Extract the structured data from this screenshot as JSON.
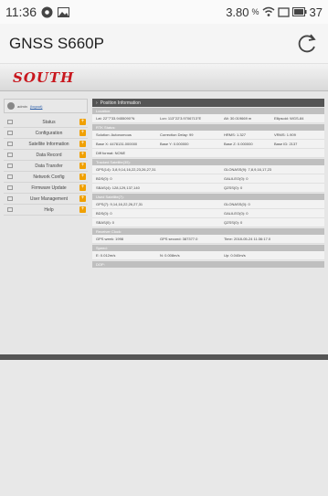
{
  "status_bar": {
    "time": "11:36",
    "battery_text": "3.80",
    "unit_text": "%",
    "trailing_text": "37"
  },
  "app_bar": {
    "title": "GNSS S660P"
  },
  "brand": {
    "logo": "SOUTH",
    "color": "#c8161d"
  },
  "user": {
    "name": "admin",
    "logout": "(logout)"
  },
  "sidebar": {
    "items": [
      {
        "label": "Status",
        "icon": "monitor-icon"
      },
      {
        "label": "Configuration",
        "icon": "tools-icon"
      },
      {
        "label": "Satellite Information",
        "icon": "satellite-icon"
      },
      {
        "label": "Data Record",
        "icon": "disk-icon"
      },
      {
        "label": "Data Transfer",
        "icon": "transfer-icon"
      },
      {
        "label": "Network Config",
        "icon": "network-icon"
      },
      {
        "label": "Firmware Update",
        "icon": "upload-icon"
      },
      {
        "label": "User Management",
        "icon": "user-icon"
      },
      {
        "label": "Help",
        "icon": "help-icon"
      }
    ]
  },
  "panel": {
    "header": "Position Information",
    "location": {
      "title": "Location:",
      "lat": "Lat: 22°7'33.9455090''N",
      "lon": "Lon: 113°22'3.9706713''E",
      "alt": "Alt: 30.019669 m",
      "ellipsoid": "Ellipsoid: WGS-84"
    },
    "rtk": {
      "title": "RTK Status:",
      "solution": "Solution: Autonomous",
      "correction_delay": "Correction Delay: 99",
      "hrms": "HRMS: 1.327",
      "vrms": "VRMS: 1.909",
      "base_x": "Base X: 4478131.000000",
      "base_y": "Base Y: 0.000000",
      "base_z": "Base Z: 0.000000",
      "base_id": "Base ID: 2137",
      "diff_format": "Diff format: NONE"
    },
    "tracked": {
      "title": "Tracked Satellite(35):",
      "gps": "GPS(14): 3,8,9,14,16,22,23,26,27,31",
      "glonass": "GLONASS(9): 7,8,9,16,17,23",
      "beidou": "BDS(0): 0",
      "galileo": "GALILEO(0): 0",
      "sbas": "SBAS(4): 128,129,137,140",
      "qzss": "QZSS(0): 0"
    },
    "used": {
      "title": "Used Satellite(7):",
      "gps": "GPS(7): 9,14,16,22,26,27,31",
      "glonass": "GLONASS(0): 0",
      "beidou": "BDS(0): 0",
      "galileo": "GALILEO(0): 0",
      "sbas": "SBAS(0): 0",
      "qzss": "QZSS(0): 0"
    },
    "clock": {
      "title": "Receiver Clock:",
      "gps_week": "GPS week: 1998",
      "gps_second": "GPS second: 387377.0",
      "time": "Time: 2018-05-24 11:36:17.0"
    },
    "speed": {
      "title": "Speed:",
      "e": "E: 0.012m/s",
      "n": "N: 0.008m/s",
      "up": "Up: 0.040m/s"
    },
    "dop": {
      "title": "DOP:"
    }
  }
}
